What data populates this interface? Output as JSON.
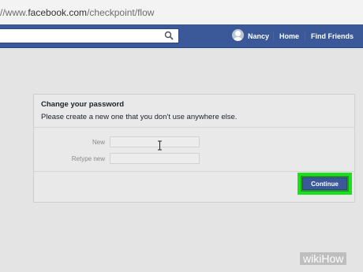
{
  "browser": {
    "url_prefix": "//www.",
    "url_domain": "facebook.com",
    "url_path": "/checkpoint/flow"
  },
  "fb_header": {
    "user_name": "Nancy",
    "home_label": "Home",
    "find_friends_label": "Find Friends",
    "search_value": ""
  },
  "card": {
    "title": "Change your password",
    "subtitle": "Please create a new one that you don't use anywhere else.",
    "fields": [
      {
        "label": "New",
        "value": ""
      },
      {
        "label": "Retype new",
        "value": ""
      }
    ],
    "continue_label": "Continue"
  },
  "watermark": "wikiHow",
  "colors": {
    "fb_blue": "#3b5998",
    "highlight_green": "#19e21a"
  }
}
